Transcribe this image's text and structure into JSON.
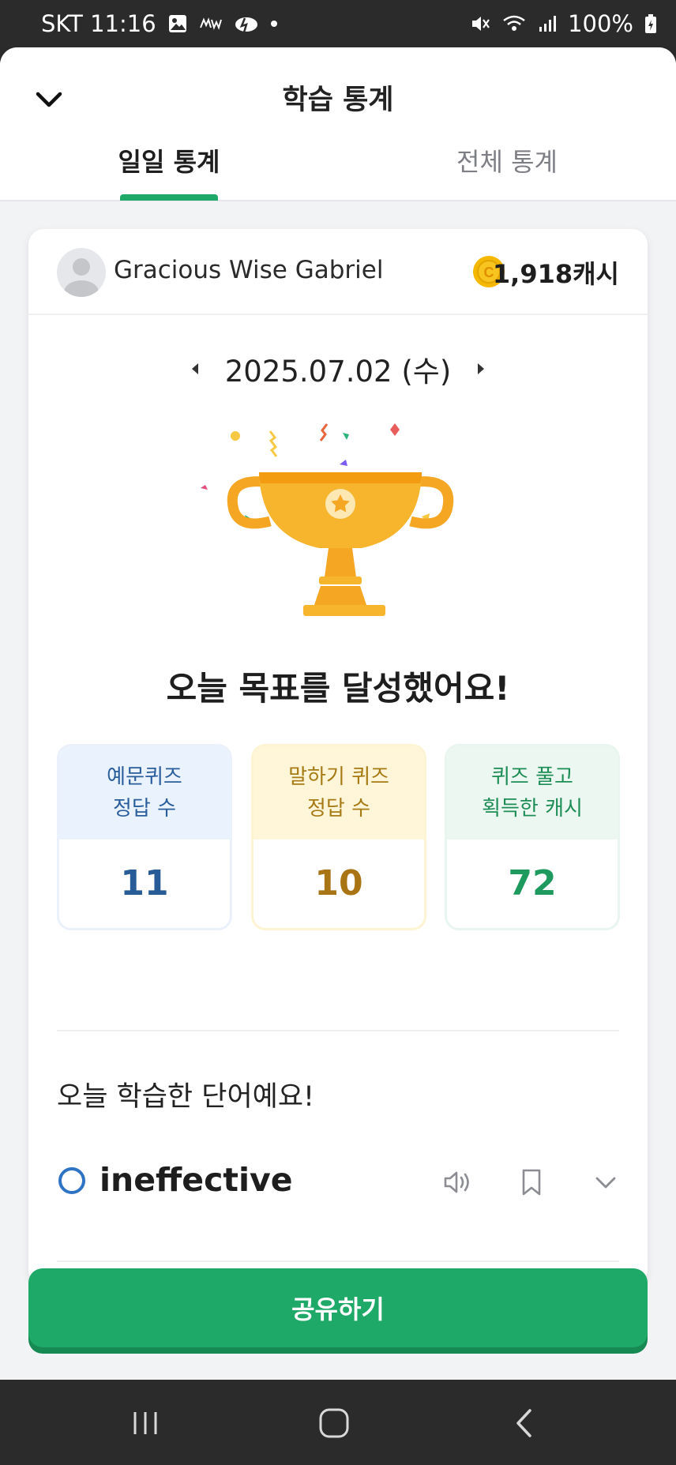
{
  "status_bar": {
    "carrier_time": "SKT 11:16",
    "battery": "100%"
  },
  "header": {
    "title": "학습 통계",
    "tabs": [
      {
        "label": "일일 통계",
        "active": true
      },
      {
        "label": "전체 통계",
        "active": false
      }
    ]
  },
  "profile": {
    "name": "Gracious Wise Gabriel",
    "cash": "1,918캐시"
  },
  "date": {
    "value": "2025.07.02 (수)"
  },
  "goal_message": "오늘 목표를 달성했어요!",
  "stats": [
    {
      "label": "예문퀴즈\n정답 수",
      "value": "11"
    },
    {
      "label": "말하기 퀴즈\n정답 수",
      "value": "10"
    },
    {
      "label": "퀴즈 풀고\n획득한 캐시",
      "value": "72"
    }
  ],
  "words_section": {
    "title": "오늘 학습한 단어예요!",
    "words": [
      {
        "word": "ineffective"
      }
    ]
  },
  "share_button": "공유하기",
  "colors": {
    "brand_green": "#1fa968",
    "blue": "#275c96",
    "yellow": "#a87414",
    "green": "#1f9a5e",
    "coin": "#f5b800"
  }
}
